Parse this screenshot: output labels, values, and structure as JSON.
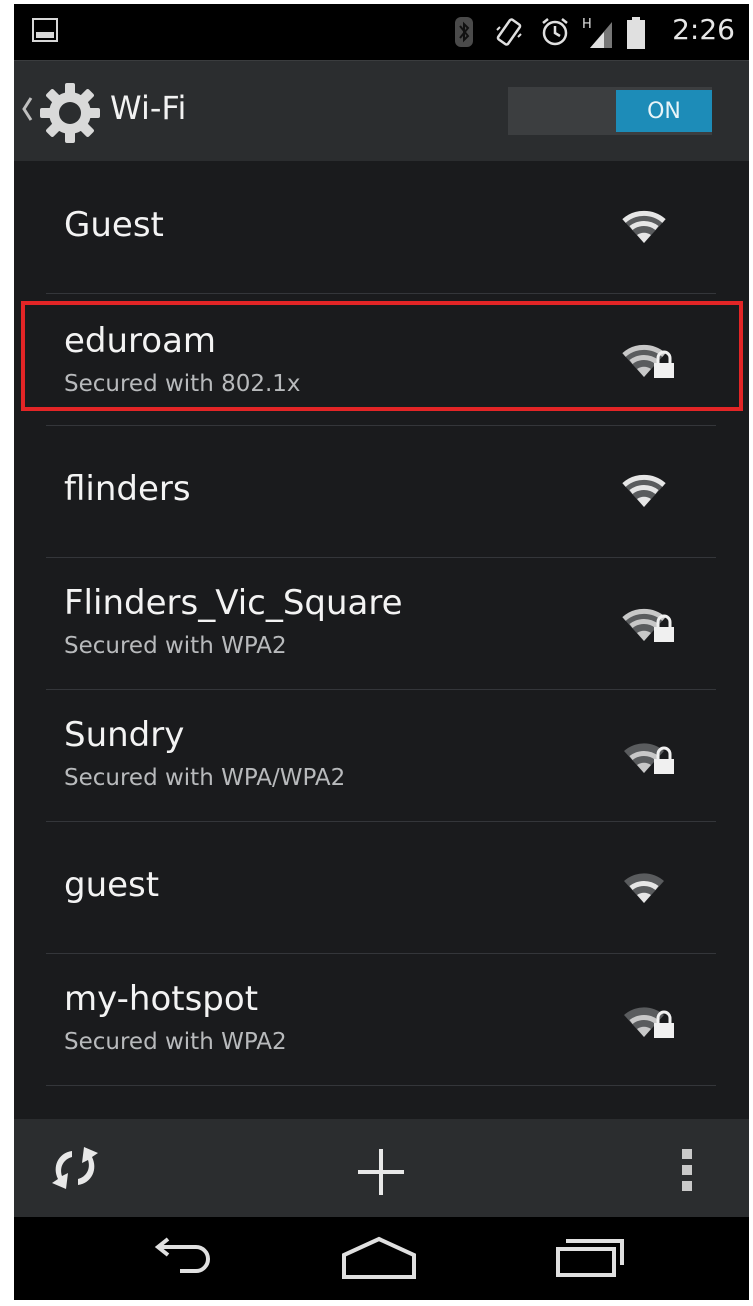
{
  "status_bar": {
    "time": "2:26",
    "icons": [
      "image-notification-icon",
      "bluetooth-icon",
      "vibrate-icon",
      "alarm-icon",
      "cell-signal-icon",
      "battery-icon"
    ],
    "signal_label": "H"
  },
  "action_bar": {
    "title": "Wi-Fi",
    "toggle_label": "ON",
    "toggle_color": "#1d8cb8"
  },
  "networks": [
    {
      "name": "Guest",
      "security": "",
      "secured": false
    },
    {
      "name": "eduroam",
      "security": "Secured with 802.1x",
      "secured": true
    },
    {
      "name": "flinders",
      "security": "",
      "secured": false
    },
    {
      "name": "Flinders_Vic_Square",
      "security": "Secured with WPA2",
      "secured": true
    },
    {
      "name": "Sundry",
      "security": "Secured with WPA/WPA2",
      "secured": true
    },
    {
      "name": "guest",
      "security": "",
      "secured": false
    },
    {
      "name": "my-hotspot",
      "security": "Secured with WPA2",
      "secured": true
    }
  ],
  "highlight_color": "#e32526",
  "bottom_bar": {
    "icons": [
      "wps-refresh-icon",
      "add-network-icon",
      "overflow-menu-icon"
    ]
  },
  "nav_bar": {
    "icons": [
      "back-icon",
      "home-icon",
      "recent-apps-icon"
    ]
  }
}
